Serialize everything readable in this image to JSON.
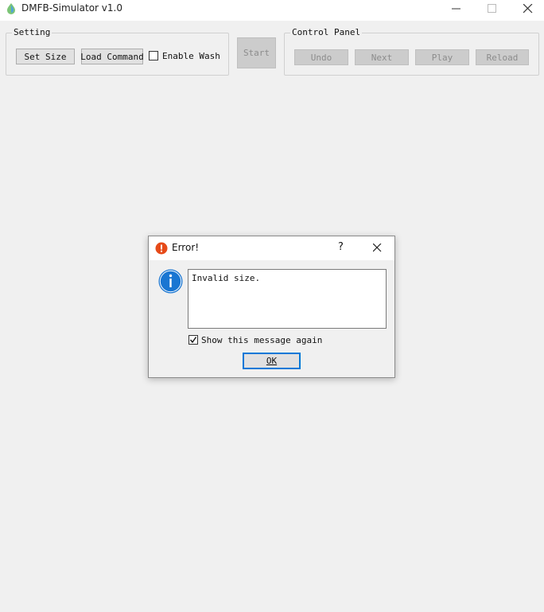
{
  "window": {
    "title": "DMFB-Simulator v1.0",
    "controls": [
      "minimize",
      "maximize",
      "close"
    ]
  },
  "setting": {
    "title": "Setting",
    "set_size_label": "Set Size",
    "load_command_label": "Load Command",
    "enable_wash_label": "Enable Wash",
    "enable_wash_checked": false
  },
  "start_label": "Start",
  "control_panel": {
    "title": "Control Panel",
    "undo_label": "Undo",
    "next_label": "Next",
    "play_label": "Play",
    "reload_label": "Reload"
  },
  "dialog": {
    "title": "Error!",
    "help_label": "?",
    "message": "Invalid size.",
    "show_again_label": "Show this message again",
    "show_again_checked": true,
    "ok_label": "OK"
  },
  "colors": {
    "window_bg": "#f0f0f0",
    "titlebar_bg": "#ffffff",
    "error_icon": "#e64a19",
    "info_icon": "#1976d2",
    "ok_border": "#0078d7"
  }
}
